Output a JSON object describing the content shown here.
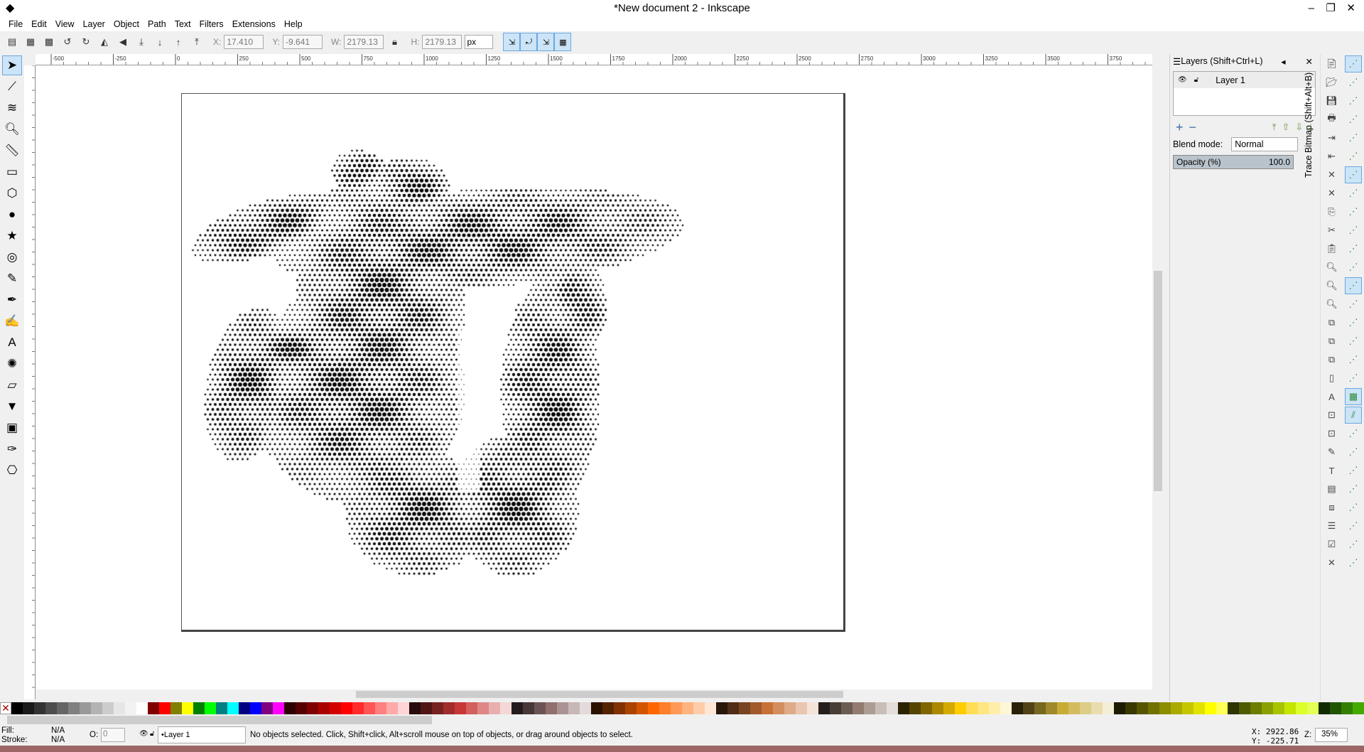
{
  "window": {
    "title": "*New document 2 - Inkscape"
  },
  "menu": [
    "File",
    "Edit",
    "View",
    "Layer",
    "Object",
    "Path",
    "Text",
    "Filters",
    "Extensions",
    "Help"
  ],
  "toolbar": {
    "x_label": "X:",
    "x": "17.410",
    "y_label": "Y:",
    "y": "-9.641",
    "w_label": "W:",
    "w": "2179.13",
    "h_label": "H:",
    "h": "2179.13",
    "unit": "px"
  },
  "ruler": {
    "h_ticks": [
      "-500",
      "-250",
      "0",
      "250",
      "500",
      "750",
      "1000",
      "1250",
      "1500",
      "1750",
      "2000",
      "2250",
      "2500",
      "2750",
      "3000",
      "3250",
      "3500",
      "3750"
    ]
  },
  "layers_panel": {
    "title": "Layers (Shift+Ctrl+L)",
    "layer_name": "Layer 1",
    "blend_label": "Blend mode:",
    "blend_value": "Normal",
    "opacity_label": "Opacity (%)",
    "opacity_value": "100.0",
    "trace_tab": "Trace Bitmap (Shift+Alt+B)"
  },
  "status": {
    "fill_label": "Fill:",
    "fill_value": "N/A",
    "stroke_label": "Stroke:",
    "stroke_value": "N/A",
    "o_label": "O:",
    "o_value": "0",
    "current_layer": "•Layer 1",
    "message": "No objects selected. Click, Shift+click, Alt+scroll mouse on top of objects, or drag around objects to select.",
    "cursor_x": "X: 2922.86",
    "cursor_y": "Y: -225.71",
    "zoom_label": "Z:",
    "zoom_value": "35%"
  },
  "palette": [
    "#000000",
    "#1a1a1a",
    "#333333",
    "#4d4d4d",
    "#666666",
    "#808080",
    "#999999",
    "#b3b3b3",
    "#cccccc",
    "#e6e6e6",
    "#f2f2f2",
    "#ffffff",
    "#800000",
    "#ff0000",
    "#808000",
    "#ffff00",
    "#008000",
    "#00ff00",
    "#008080",
    "#00ffff",
    "#000080",
    "#0000ff",
    "#800080",
    "#ff00ff",
    "#2b0000",
    "#550000",
    "#800000",
    "#aa0000",
    "#d40000",
    "#ff0000",
    "#ff2a2a",
    "#ff5555",
    "#ff8080",
    "#ffaaaa",
    "#ffd5d5",
    "#280b0b",
    "#501616",
    "#782121",
    "#a02c2c",
    "#c83737",
    "#d35f5f",
    "#de8787",
    "#e9afaf",
    "#f4d7d7",
    "#241c1c",
    "#483737",
    "#6c5353",
    "#916f6f",
    "#ac9393",
    "#c8b7b7",
    "#e3dbdb",
    "#2b1100",
    "#552200",
    "#803300",
    "#aa4400",
    "#d45500",
    "#ff6600",
    "#ff7f2a",
    "#ff9955",
    "#ffb380",
    "#ffccaa",
    "#ffe6d5",
    "#28170b",
    "#502d16",
    "#784421",
    "#a05a2c",
    "#c87137",
    "#d38d5f",
    "#deaa87",
    "#e9c6af",
    "#f4e3d7",
    "#241f1c",
    "#483e37",
    "#6c5d53",
    "#917c6f",
    "#ac9d93",
    "#c8beb7",
    "#e3dedb",
    "#2b2200",
    "#554400",
    "#806600",
    "#aa8800",
    "#d4aa00",
    "#ffcc00",
    "#ffdd55",
    "#ffe680",
    "#ffeeaa",
    "#fff6d5",
    "#28220b",
    "#504416",
    "#786721",
    "#a0892c",
    "#c8ab37",
    "#d3bc5f",
    "#decd87",
    "#e9ddaf",
    "#f4eed7",
    "#1c1c00",
    "#383800",
    "#555500",
    "#717100",
    "#8d8d00",
    "#aaaa00",
    "#c6c600",
    "#e2e200",
    "#ffff00",
    "#ffff55",
    "#2d3500",
    "#4e5b00",
    "#6b7c00",
    "#8aa000",
    "#a8c400",
    "#c4e500",
    "#dcff2a",
    "#e5ff55",
    "#112b00",
    "#225500",
    "#338000",
    "#44aa00",
    "#55d400",
    "#66ff00",
    "#7fff2a",
    "#99ff55",
    "#b3ff80"
  ],
  "icons": {
    "left_tools": [
      "select-arrow",
      "node-edit",
      "tweak",
      "zoom",
      "measure",
      "rectangle",
      "3d-box",
      "ellipse",
      "star",
      "spiral",
      "pencil",
      "pen",
      "calligraphy",
      "text",
      "spray",
      "eraser",
      "paint-bucket",
      "gradient",
      "dropper",
      "connector"
    ]
  }
}
